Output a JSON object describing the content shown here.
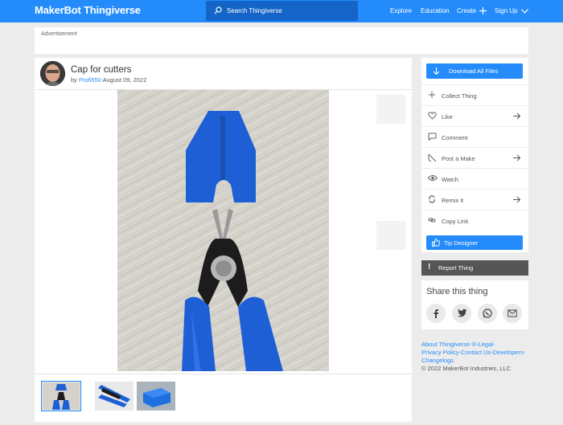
{
  "header": {
    "logo_bold": "MakerBot",
    "logo_light": "Thingiverse",
    "search_placeholder": "Search Thingiverse",
    "nav": {
      "explore": "Explore",
      "education": "Education",
      "create": "Create",
      "signup": "Sign Up"
    },
    "accent": "#248bfb"
  },
  "advert": {
    "label": "Advertisement"
  },
  "thing": {
    "title": "Cap for cutters",
    "by": "by",
    "author": "Profi550",
    "date": "August 09, 2022"
  },
  "thumbnails": [
    "thumbnail-cutters-with-cap",
    "thumbnail-blue-pliers-flat",
    "thumbnail-cap-render"
  ],
  "sidebar": {
    "download": "Download All Files",
    "collect": "Collect Thing",
    "like": "Like",
    "comment": "Comment",
    "post_make": "Post a Make",
    "watch": "Watch",
    "remix": "Remix it",
    "copy_link": "Copy Link",
    "tip": "Tip Designer",
    "report": "Report Thing"
  },
  "share": {
    "title": "Share this thing",
    "icons": [
      "facebook-icon",
      "twitter-icon",
      "whatsapp-icon",
      "email-icon"
    ]
  },
  "footer": {
    "line1a": "About Thingiverse ®",
    "line1b": "-Legal-",
    "line2a": "Privacy Policy",
    "line2b": "-Contact Us-",
    "line2c": "Developers-",
    "line3": "Changelogs",
    "copyright": "© 2022 MakerBot Industries, LLC"
  }
}
